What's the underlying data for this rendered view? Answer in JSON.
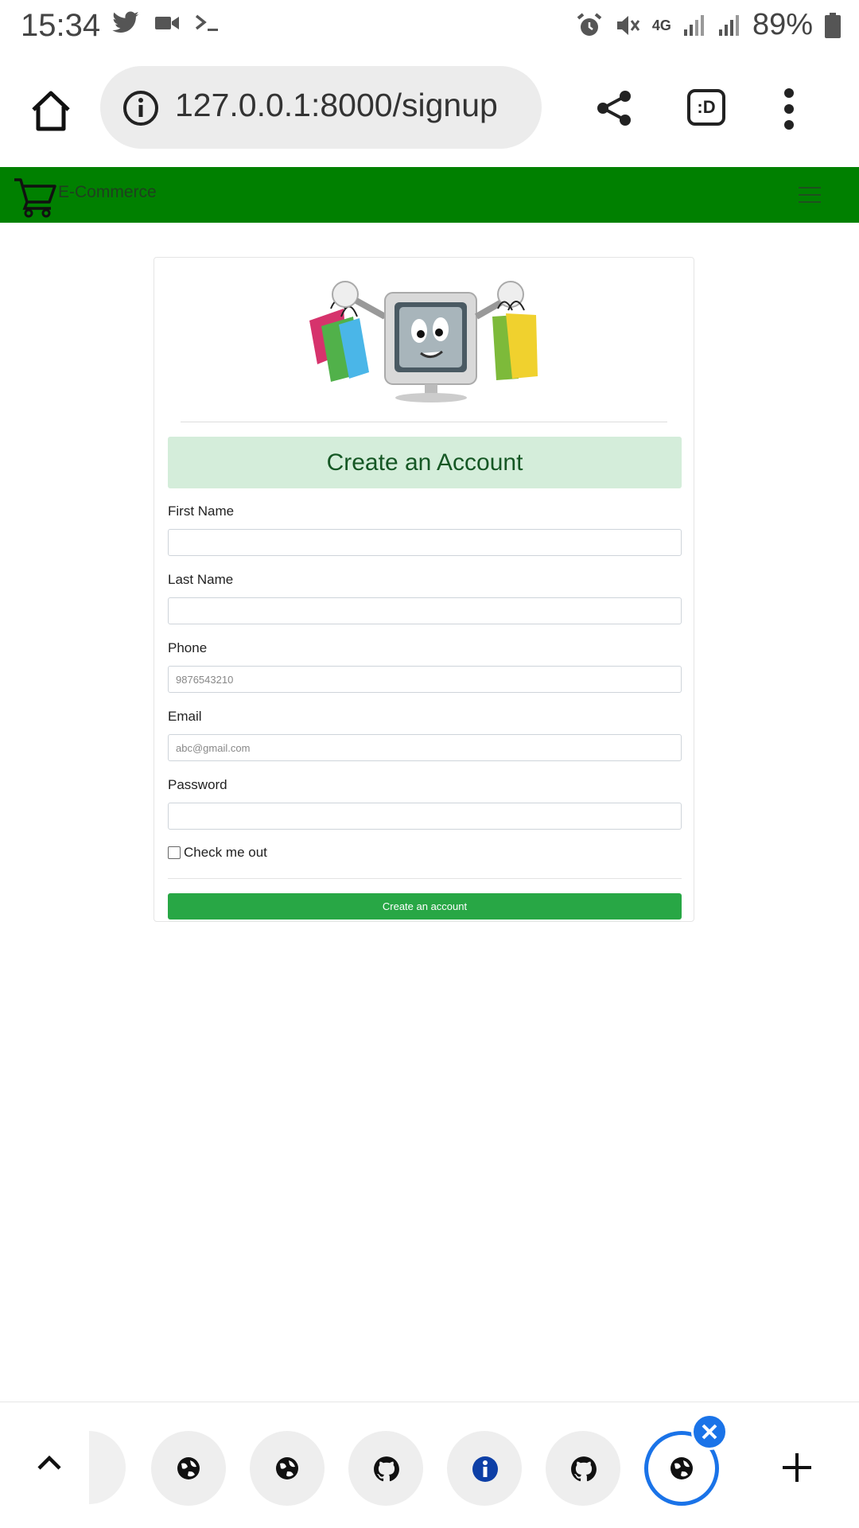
{
  "status_bar": {
    "time": "15:34",
    "battery": "89%",
    "network": "4G",
    "icons": [
      "twitter-icon",
      "video-icon",
      "terminal-icon",
      "alarm-icon",
      "mute-icon",
      "signal-icon",
      "battery-icon"
    ]
  },
  "browser": {
    "url": "127.0.0.1:8000/signup",
    "tabs_label": ":D"
  },
  "navbar": {
    "brand": "E-Commerce",
    "color": "#008000"
  },
  "form": {
    "heading": "Create an Account",
    "fields": [
      {
        "label": "First Name",
        "value": "",
        "placeholder": ""
      },
      {
        "label": "Last Name",
        "value": "",
        "placeholder": ""
      },
      {
        "label": "Phone",
        "value": "",
        "placeholder": "9876543210"
      },
      {
        "label": "Email",
        "value": "",
        "placeholder": "abc@gmail.com"
      },
      {
        "label": "Password",
        "value": "",
        "placeholder": ""
      }
    ],
    "checkbox_label": "Check me out",
    "checkbox_checked": false,
    "submit_label": "Create an account",
    "heading_bg": "#d4edda",
    "button_color": "#28a745"
  },
  "tab_strip": {
    "tabs": [
      "globe-icon",
      "globe-icon",
      "github-icon",
      "info-icon",
      "github-icon",
      "globe-icon"
    ],
    "active_index": 5,
    "accent": "#1a73e8"
  }
}
